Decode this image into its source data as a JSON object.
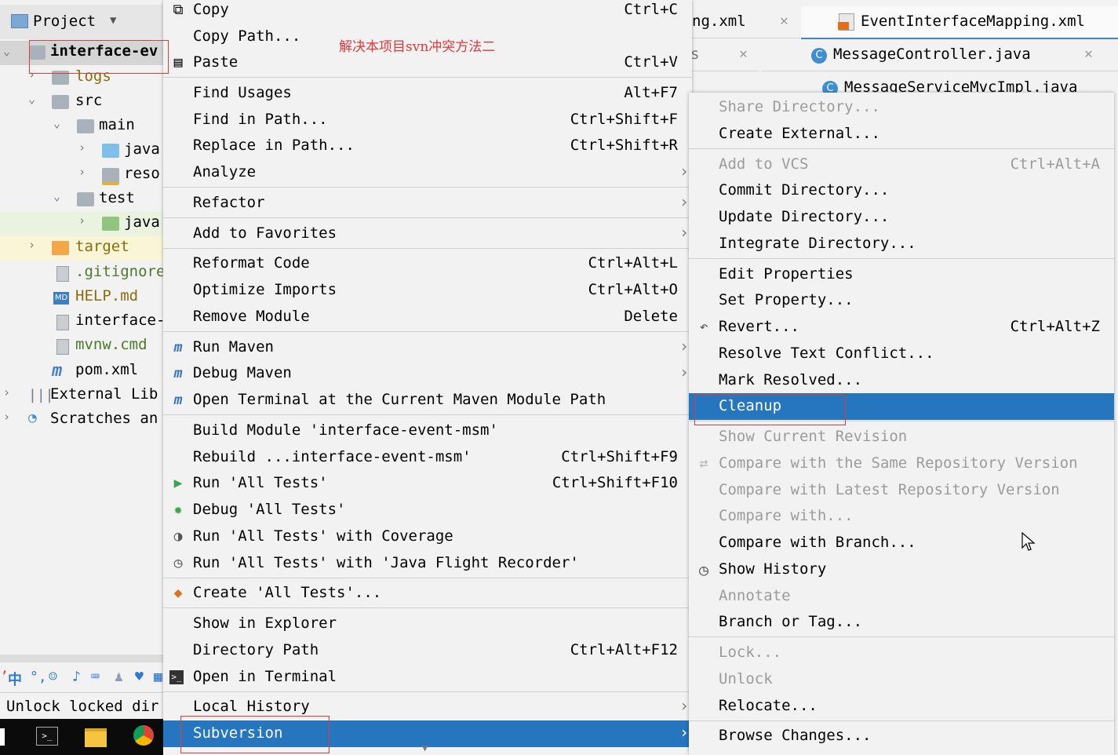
{
  "project_panel": {
    "title": "Project",
    "tree": [
      {
        "label": "interface-ev",
        "type": "module",
        "arrow": "expanded"
      },
      {
        "label": "logs",
        "type": "folder",
        "arrow": "collapsed"
      },
      {
        "label": "src",
        "type": "folder",
        "arrow": "expanded"
      },
      {
        "label": "main",
        "type": "folder",
        "arrow": "expanded"
      },
      {
        "label": "java",
        "type": "folder-blue",
        "arrow": "collapsed"
      },
      {
        "label": "reso",
        "type": "folder-res",
        "arrow": "collapsed"
      },
      {
        "label": "test",
        "type": "folder",
        "arrow": "expanded"
      },
      {
        "label": "java",
        "type": "folder-green",
        "arrow": "collapsed"
      },
      {
        "label": "target",
        "type": "folder-orange",
        "arrow": "collapsed"
      },
      {
        "label": ".gitignore",
        "type": "file"
      },
      {
        "label": "HELP.md",
        "type": "md"
      },
      {
        "label": "interface-",
        "type": "file"
      },
      {
        "label": "mvnw.cmd",
        "type": "file"
      },
      {
        "label": "pom.xml",
        "type": "maven"
      },
      {
        "label": "External Lib",
        "type": "libs",
        "arrow": "collapsed"
      },
      {
        "label": "Scratches an",
        "type": "scratch",
        "arrow": "collapsed"
      }
    ],
    "status_text": "Unlock locked dir"
  },
  "annotation_text": "解决本项目svn冲突方法二",
  "tabs": [
    {
      "label": "ng.xml"
    },
    {
      "label": "EventInterfaceMapping.xml"
    },
    {
      "label": "MessageController.java"
    },
    {
      "label": "MessageServiceMvcImpl.java"
    }
  ],
  "context_menu": {
    "items": [
      {
        "label": "Copy",
        "shortcut": "Ctrl+C",
        "icon": "copy-icon"
      },
      {
        "label": "Copy Path...",
        "shortcut": ""
      },
      {
        "label": "Paste",
        "shortcut": "Ctrl+V",
        "icon": "paste-icon"
      },
      {
        "label": "Find Usages",
        "shortcut": "Alt+F7"
      },
      {
        "label": "Find in Path...",
        "shortcut": "Ctrl+Shift+F"
      },
      {
        "label": "Replace in Path...",
        "shortcut": "Ctrl+Shift+R"
      },
      {
        "label": "Analyze",
        "submenu": true
      },
      {
        "label": "Refactor",
        "submenu": true
      },
      {
        "label": "Add to Favorites",
        "submenu": true
      },
      {
        "label": "Reformat Code",
        "shortcut": "Ctrl+Alt+L"
      },
      {
        "label": "Optimize Imports",
        "shortcut": "Ctrl+Alt+O"
      },
      {
        "label": "Remove Module",
        "shortcut": "Delete"
      },
      {
        "label": "Run Maven",
        "submenu": true,
        "icon": "maven-run-icon"
      },
      {
        "label": "Debug Maven",
        "submenu": true,
        "icon": "maven-debug-icon"
      },
      {
        "label": "Open Terminal at the Current Maven Module Path",
        "icon": "terminal-maven-icon"
      },
      {
        "label": "Build Module 'interface-event-msm'",
        "shortcut": ""
      },
      {
        "label": "Rebuild ...interface-event-msm'",
        "shortcut": "Ctrl+Shift+F9"
      },
      {
        "label": "Run 'All Tests'",
        "shortcut": "Ctrl+Shift+F10",
        "icon": "run-icon"
      },
      {
        "label": "Debug 'All Tests'",
        "icon": "debug-icon"
      },
      {
        "label": "Run 'All Tests' with Coverage",
        "icon": "coverage-icon"
      },
      {
        "label": "Run 'All Tests' with 'Java Flight Recorder'",
        "icon": "profiler-icon"
      },
      {
        "label": "Create 'All Tests'...",
        "icon": "create-config-icon"
      },
      {
        "label": "Show in Explorer"
      },
      {
        "label": "Directory Path",
        "shortcut": "Ctrl+Alt+F12"
      },
      {
        "label": "Open in Terminal",
        "icon": "terminal-icon"
      },
      {
        "label": "Local History",
        "submenu": true
      },
      {
        "label": "Subversion",
        "submenu": true,
        "selected": true
      }
    ]
  },
  "svn_submenu": {
    "items": [
      {
        "label": "Share Directory...",
        "disabled": true
      },
      {
        "label": "Create External..."
      },
      {
        "label": "Add to VCS",
        "shortcut": "Ctrl+Alt+A",
        "disabled": true
      },
      {
        "label": "Commit Directory..."
      },
      {
        "label": "Update Directory..."
      },
      {
        "label": "Integrate Directory..."
      },
      {
        "label": "Edit Properties"
      },
      {
        "label": "Set Property..."
      },
      {
        "label": "Revert...",
        "shortcut": "Ctrl+Alt+Z",
        "icon": "revert-icon"
      },
      {
        "label": "Resolve Text Conflict..."
      },
      {
        "label": "Mark Resolved..."
      },
      {
        "label": "Cleanup",
        "selected": true
      },
      {
        "label": "Show Current Revision",
        "disabled": true
      },
      {
        "label": "Compare with the Same Repository Version",
        "disabled": true,
        "icon": "compare-icon"
      },
      {
        "label": "Compare with Latest Repository Version",
        "disabled": true
      },
      {
        "label": "Compare with...",
        "disabled": true
      },
      {
        "label": "Compare with Branch..."
      },
      {
        "label": "Show History",
        "icon": "history-icon"
      },
      {
        "label": "Annotate",
        "disabled": true
      },
      {
        "label": "Branch or Tag..."
      },
      {
        "label": "Lock...",
        "disabled": true
      },
      {
        "label": "Unlock",
        "disabled": true
      },
      {
        "label": "Relocate..."
      },
      {
        "label": "Browse Changes..."
      }
    ]
  },
  "colors": {
    "selection": "#2675bf",
    "menu_bg": "#f2f2f2",
    "disabled_text": "#9b9b9b",
    "annotation_red": "#e23a3a"
  }
}
